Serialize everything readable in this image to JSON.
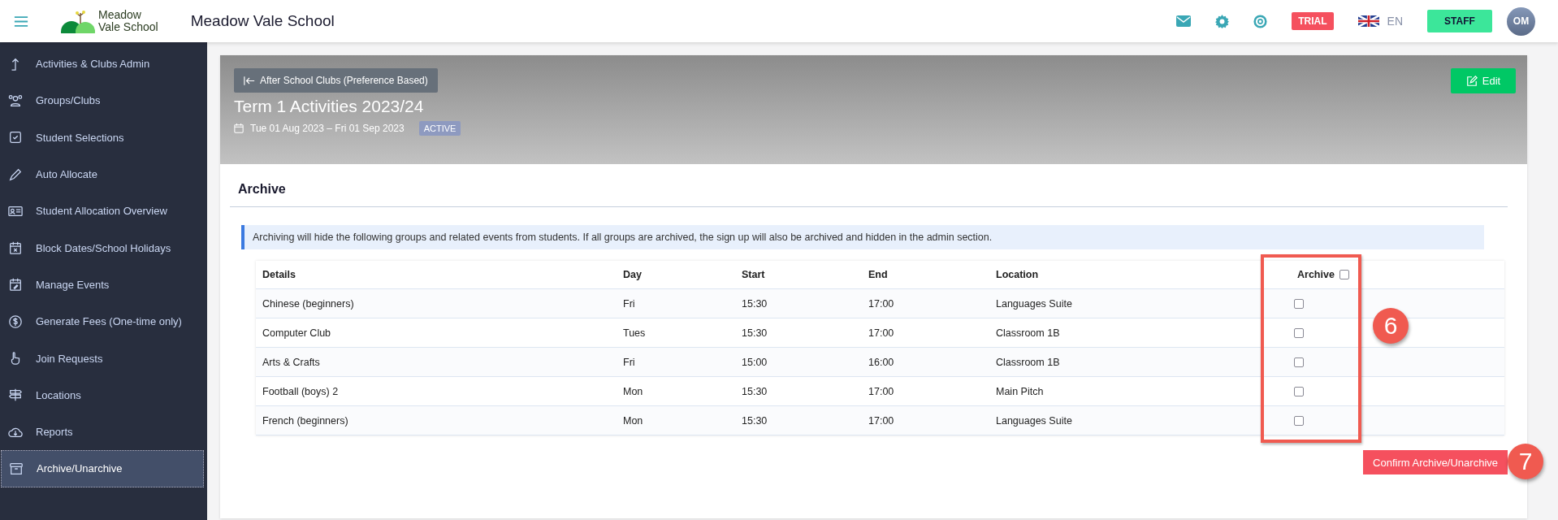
{
  "topbar": {
    "logo_line_1": "Meadow",
    "logo_line_2": "Vale School",
    "school_name": "Meadow Vale School",
    "trial_badge": "TRIAL",
    "language": "EN",
    "role_button": "STAFF",
    "avatar_initials": "OM"
  },
  "sidebar": {
    "items": [
      {
        "label": "Activities & Clubs Admin",
        "kind": "arrow",
        "selected": false
      },
      {
        "label": "Groups/Clubs",
        "kind": "people",
        "selected": false
      },
      {
        "label": "Student Selections",
        "kind": "checkbox",
        "selected": false
      },
      {
        "label": "Auto Allocate",
        "kind": "pencil",
        "selected": false
      },
      {
        "label": "Student Allocation Overview",
        "kind": "idcard",
        "selected": false
      },
      {
        "label": "Block Dates/School Holidays",
        "kind": "calendarx",
        "selected": false
      },
      {
        "label": "Manage Events",
        "kind": "calendaredit",
        "selected": false
      },
      {
        "label": "Generate Fees (One-time only)",
        "kind": "dollar",
        "selected": false
      },
      {
        "label": "Join Requests",
        "kind": "hand",
        "selected": false
      },
      {
        "label": "Locations",
        "kind": "signpost",
        "selected": false
      },
      {
        "label": "Reports",
        "kind": "cloud",
        "selected": false
      },
      {
        "label": "Archive/Unarchive",
        "kind": "archive",
        "selected": true
      }
    ]
  },
  "banner": {
    "back_button": "After School Clubs (Preference Based)",
    "edit_button": "Edit",
    "title": "Term 1 Activities 2023/24",
    "date_range": "Tue 01 Aug 2023 – Fri 01 Sep 2023",
    "status_badge": "ACTIVE"
  },
  "section": {
    "heading": "Archive",
    "info": "Archiving will hide the following groups and related events from students. If all groups are archived, the sign up will also be archived and hidden in the admin section."
  },
  "table": {
    "columns": [
      "Details",
      "Day",
      "Start",
      "End",
      "Location",
      "Archive"
    ],
    "select_all_checked": false,
    "rows": [
      {
        "details": "Chinese (beginners)",
        "day": "Fri",
        "start": "15:30",
        "end": "17:00",
        "location": "Languages Suite",
        "checked": false
      },
      {
        "details": "Computer Club",
        "day": "Tues",
        "start": "15:30",
        "end": "17:00",
        "location": "Classroom 1B",
        "checked": false
      },
      {
        "details": "Arts & Crafts",
        "day": "Fri",
        "start": "15:00",
        "end": "16:00",
        "location": "Classroom 1B",
        "checked": false
      },
      {
        "details": "Football (boys) 2",
        "day": "Mon",
        "start": "15:30",
        "end": "17:00",
        "location": "Main Pitch",
        "checked": false
      },
      {
        "details": "French (beginners)",
        "day": "Mon",
        "start": "15:30",
        "end": "17:00",
        "location": "Languages Suite",
        "checked": false
      }
    ]
  },
  "confirm_button": "Confirm Archive/Unarchive",
  "callouts": [
    "6",
    "7"
  ]
}
